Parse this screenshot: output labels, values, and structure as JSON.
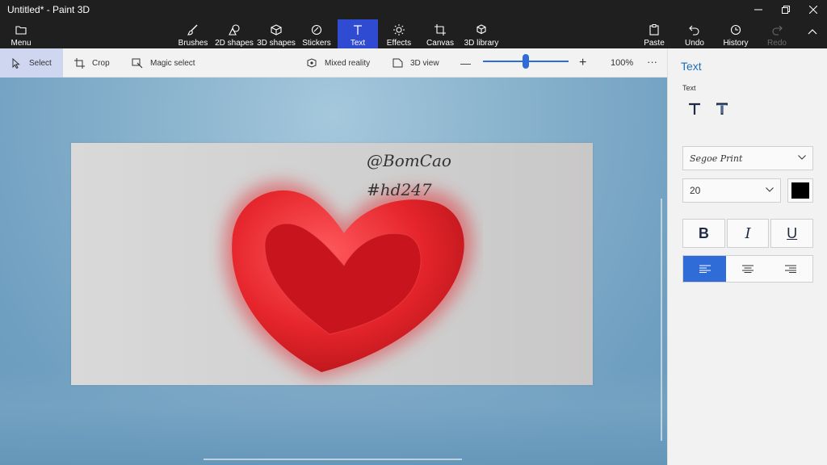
{
  "window": {
    "title": "Untitled* - Paint 3D"
  },
  "ribbon": {
    "menu": "Menu",
    "tools": [
      {
        "label": "Brushes",
        "icon": "brush-icon"
      },
      {
        "label": "2D shapes",
        "icon": "shapes-2d-icon"
      },
      {
        "label": "3D shapes",
        "icon": "cube-icon"
      },
      {
        "label": "Stickers",
        "icon": "sticker-icon"
      },
      {
        "label": "Text",
        "icon": "text-icon",
        "active": true
      },
      {
        "label": "Effects",
        "icon": "sun-icon"
      },
      {
        "label": "Canvas",
        "icon": "crop-canvas-icon"
      },
      {
        "label": "3D library",
        "icon": "library-icon"
      }
    ],
    "paste": "Paste",
    "undo": "Undo",
    "history": "History",
    "redo": "Redo"
  },
  "toolbar2": {
    "select": "Select",
    "crop": "Crop",
    "magic_select": "Magic select",
    "mixed_reality": "Mixed reality",
    "view_3d": "3D view",
    "zoom_minus": "—",
    "zoom_plus": "+",
    "zoom_percent": "100%",
    "zoom_fraction": 0.5,
    "more": "···"
  },
  "canvas": {
    "text_line1": "@BomCao",
    "text_line2": "#hd247",
    "colors": {
      "heart": "#e5252b",
      "heart_inner": "#c8141c",
      "paper": "#d4d4d4"
    }
  },
  "panel": {
    "title": "Text",
    "subtitle": "Text",
    "font": "Segoe Print",
    "size": "20",
    "color": "#000000",
    "bold": "B",
    "italic": "I",
    "underline": "U",
    "accent": "#2f6cd8"
  }
}
